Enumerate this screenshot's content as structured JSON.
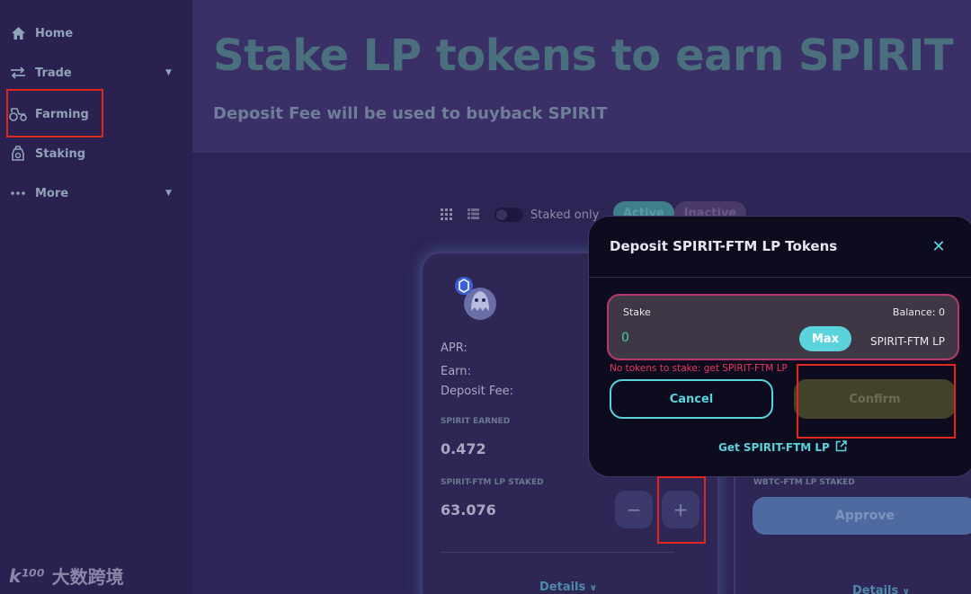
{
  "sidebar": {
    "items": [
      {
        "label": "Home",
        "icon": "home-icon"
      },
      {
        "label": "Trade",
        "icon": "trade-icon"
      },
      {
        "label": "Farming",
        "icon": "tractor-icon"
      },
      {
        "label": "Staking",
        "icon": "staking-icon"
      },
      {
        "label": "More",
        "icon": "more-icon"
      }
    ]
  },
  "header": {
    "title": "Stake LP tokens to earn SPIRIT",
    "subtitle": "Deposit Fee will be used to buyback SPIRIT"
  },
  "toolbar": {
    "staked_only_label": "Staked only",
    "active_tab": "Active",
    "inactive_tab": "Inactive"
  },
  "card": {
    "apr_label": "APR:",
    "earn_label": "Earn:",
    "deposit_fee_label": "Deposit Fee:",
    "earned_label": "SPIRIT EARNED",
    "earned_value": "0.472",
    "staked_label": "SPIRIT-FTM LP STAKED",
    "staked_value": "63.076",
    "minus_label": "−",
    "plus_label": "+",
    "details_label": "Details"
  },
  "card2": {
    "staked_label": "WBTC-FTM LP STAKED",
    "approve_label": "Approve",
    "details_label": "Details"
  },
  "modal": {
    "title": "Deposit SPIRIT-FTM LP Tokens",
    "stake_label": "Stake",
    "balance_label": "Balance: 0",
    "stake_value": "0",
    "max_label": "Max",
    "lp_name": "SPIRIT-FTM LP",
    "error": "No tokens to stake: get SPIRIT-FTM LP",
    "cancel_label": "Cancel",
    "confirm_label": "Confirm",
    "get_lp_label": "Get SPIRIT-FTM LP"
  },
  "watermark": {
    "logo": "k¹⁰⁰",
    "text": "大数跨境"
  },
  "colors": {
    "accent": "#5bd3dd",
    "highlight": "#e0271f",
    "error": "#e8395f"
  }
}
